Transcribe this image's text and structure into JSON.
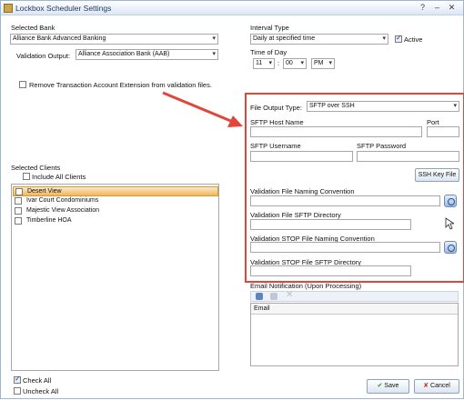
{
  "window": {
    "title": "Lockbox Scheduler Settings",
    "controls": [
      "?",
      "–",
      "✕"
    ]
  },
  "bank": {
    "label": "Selected Bank",
    "value": "Alliance Bank Advanced Banking",
    "validation_label": "Validation Output:",
    "validation_value": "Alliance Association Bank (AAB)"
  },
  "interval": {
    "label": "Interval Type",
    "value": "Daily at specified time",
    "active_label": "Active",
    "time_label": "Time of Day",
    "hour": "11",
    "minute": "00",
    "ampm": "PM",
    "separator": ":"
  },
  "remove_ext_label": "Remove Transaction Account Extension from validation files.",
  "sftp": {
    "file_output_label": "File Output Type:",
    "file_output_value": "SFTP over SSH",
    "host_label": "SFTP Host Name",
    "port_label": "Port",
    "username_label": "SFTP Username",
    "password_label": "SFTP Password",
    "ssh_key_button": "SSH Key File",
    "naming_label": "Validation File Naming Convention",
    "dir_label": "Validation File SFTP Directory",
    "stop_naming_label": "Validation STOP File Naming Convention",
    "stop_dir_label": "Validation STOP File SFTP Directory"
  },
  "clients": {
    "label": "Selected Clients",
    "include_all_label": "Include All Clients",
    "items": [
      {
        "name": "Desert View",
        "selected": true
      },
      {
        "name": "Ivar Court Condominiums",
        "selected": false
      },
      {
        "name": "Majestic View Association",
        "selected": false
      },
      {
        "name": "Timberline HOA",
        "selected": false
      }
    ],
    "check_all_label": "Check All",
    "uncheck_all_label": "Uncheck All"
  },
  "email": {
    "label": "Email Notification (Upon Processing)",
    "column": "Email"
  },
  "footer": {
    "save_label": "Save",
    "cancel_label": "Cancel"
  },
  "colors": {
    "highlight_border": "#e2463a",
    "arrow": "#e2463a",
    "selection": "#f2b75a"
  }
}
